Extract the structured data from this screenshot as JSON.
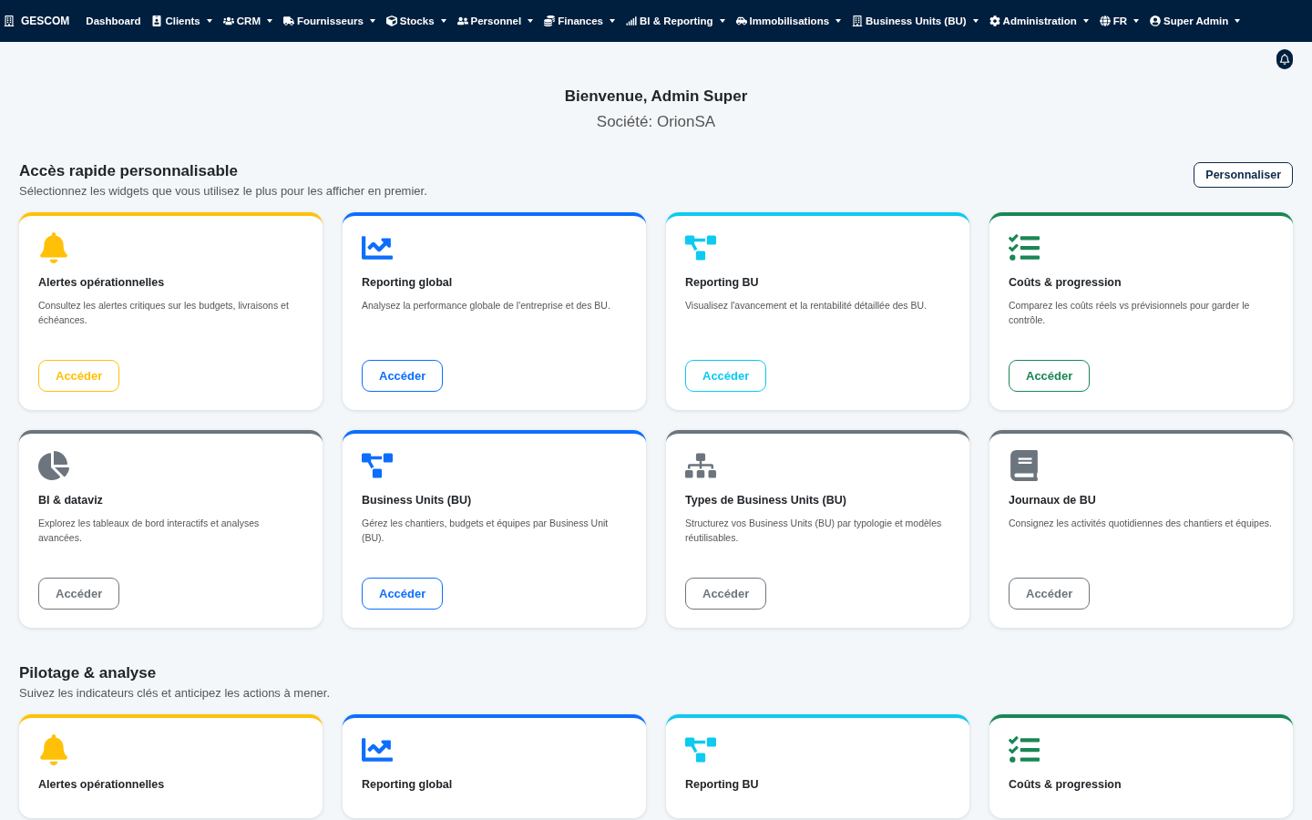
{
  "navbar": {
    "brand": "GESCOM",
    "items": [
      {
        "label": "Dashboard",
        "dropdown": false
      },
      {
        "label": "Clients",
        "dropdown": true
      },
      {
        "label": "CRM",
        "dropdown": true
      },
      {
        "label": "Fournisseurs",
        "dropdown": true
      },
      {
        "label": "Stocks",
        "dropdown": true
      },
      {
        "label": "Personnel",
        "dropdown": true
      },
      {
        "label": "Finances",
        "dropdown": true
      },
      {
        "label": "BI & Reporting",
        "dropdown": true
      },
      {
        "label": "Immobilisations",
        "dropdown": true
      },
      {
        "label": "Business Units (BU)",
        "dropdown": true
      },
      {
        "label": "Administration",
        "dropdown": true
      },
      {
        "label": "FR",
        "dropdown": true
      },
      {
        "label": "Super Admin",
        "dropdown": true
      }
    ]
  },
  "welcome": {
    "title": "Bienvenue, Admin Super",
    "company": "Société: OrionSA"
  },
  "sections": [
    {
      "title": "Accès rapide personnalisable",
      "subtitle": "Sélectionnez les widgets que vous utilisez le plus pour les afficher en premier.",
      "action": "Personnaliser",
      "cards": [
        {
          "kind": "bell",
          "color": "#ffc107",
          "title": "Alertes opérationnelles",
          "description": "Consultez les alertes critiques sur les budgets, livraisons et échéances.",
          "button": "Accéder"
        },
        {
          "kind": "chart",
          "color": "#0d6efd",
          "title": "Reporting global",
          "description": "Analysez la performance globale de l'entreprise et des BU.",
          "button": "Accéder"
        },
        {
          "kind": "diagram",
          "color": "#0dcaf0",
          "title": "Reporting BU",
          "description": "Visualisez l'avancement et la rentabilité détaillée des BU.",
          "button": "Accéder"
        },
        {
          "kind": "tasks",
          "color": "#198754",
          "title": "Coûts & progression",
          "description": "Comparez les coûts réels vs prévisionnels pour garder le contrôle.",
          "button": "Accéder"
        },
        {
          "kind": "pie",
          "color": "#6c757d",
          "title": "BI & dataviz",
          "description": "Explorez les tableaux de bord interactifs et analyses avancées.",
          "button": "Accéder"
        },
        {
          "kind": "diagram",
          "color": "#0d6efd",
          "title": "Business Units (BU)",
          "description": "Gérez les chantiers, budgets et équipes par Business Unit (BU).",
          "button": "Accéder"
        },
        {
          "kind": "sitemap",
          "color": "#6c757d",
          "title": "Types de Business Units (BU)",
          "description": "Structurez vos Business Units (BU) par typologie et modèles réutilisables.",
          "button": "Accéder"
        },
        {
          "kind": "book",
          "color": "#6c757d",
          "title": "Journaux de BU",
          "description": "Consignez les activités quotidiennes des chantiers et équipes.",
          "button": "Accéder"
        }
      ]
    },
    {
      "title": "Pilotage & analyse",
      "subtitle": "Suivez les indicateurs clés et anticipez les actions à mener.",
      "cards": [
        {
          "kind": "bell",
          "color": "#ffc107",
          "title": "Alertes opérationnelles"
        },
        {
          "kind": "chart",
          "color": "#0d6efd",
          "title": "Reporting global"
        },
        {
          "kind": "diagram",
          "color": "#0dcaf0",
          "title": "Reporting BU"
        },
        {
          "kind": "tasks",
          "color": "#198754",
          "title": "Coûts & progression"
        }
      ]
    }
  ]
}
